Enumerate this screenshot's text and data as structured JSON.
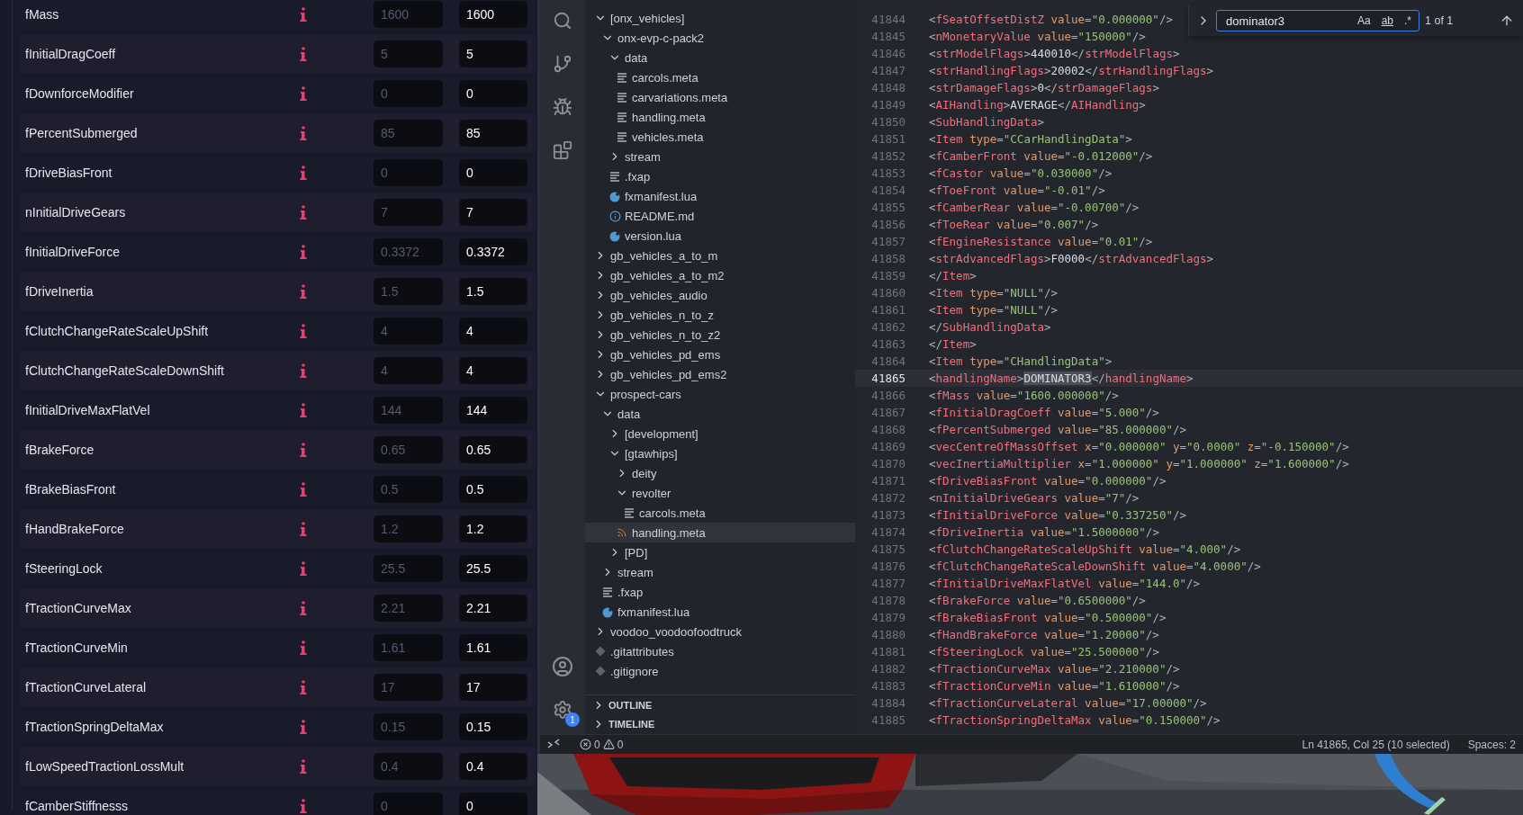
{
  "parameters": [
    {
      "name": "fMass",
      "placeholder": "1600",
      "value": "1600"
    },
    {
      "name": "fInitialDragCoeff",
      "placeholder": "5",
      "value": "5"
    },
    {
      "name": "fDownforceModifier",
      "placeholder": "0",
      "value": "0"
    },
    {
      "name": "fPercentSubmerged",
      "placeholder": "85",
      "value": "85"
    },
    {
      "name": "fDriveBiasFront",
      "placeholder": "0",
      "value": "0"
    },
    {
      "name": "nInitialDriveGears",
      "placeholder": "7",
      "value": "7"
    },
    {
      "name": "fInitialDriveForce",
      "placeholder": "0.3372",
      "value": "0.3372"
    },
    {
      "name": "fDriveInertia",
      "placeholder": "1.5",
      "value": "1.5"
    },
    {
      "name": "fClutchChangeRateScaleUpShift",
      "placeholder": "4",
      "value": "4"
    },
    {
      "name": "fClutchChangeRateScaleDownShift",
      "placeholder": "4",
      "value": "4"
    },
    {
      "name": "fInitialDriveMaxFlatVel",
      "placeholder": "144",
      "value": "144"
    },
    {
      "name": "fBrakeForce",
      "placeholder": "0.65",
      "value": "0.65"
    },
    {
      "name": "fBrakeBiasFront",
      "placeholder": "0.5",
      "value": "0.5"
    },
    {
      "name": "fHandBrakeForce",
      "placeholder": "1.2",
      "value": "1.2"
    },
    {
      "name": "fSteeringLock",
      "placeholder": "25.5",
      "value": "25.5"
    },
    {
      "name": "fTractionCurveMax",
      "placeholder": "2.21",
      "value": "2.21"
    },
    {
      "name": "fTractionCurveMin",
      "placeholder": "1.61",
      "value": "1.61"
    },
    {
      "name": "fTractionCurveLateral",
      "placeholder": "17",
      "value": "17"
    },
    {
      "name": "fTractionSpringDeltaMax",
      "placeholder": "0.15",
      "value": "0.15"
    },
    {
      "name": "fLowSpeedTractionLossMult",
      "placeholder": "0.4",
      "value": "0.4"
    },
    {
      "name": "fCamberStiffnesss",
      "placeholder": "0",
      "value": "0"
    }
  ],
  "activity_bar": {
    "settings_badge": "1"
  },
  "explorer": {
    "tree": [
      {
        "label": "[onx_vehicles]",
        "kind": "folder",
        "expanded": true,
        "selected": false,
        "children": [
          {
            "label": "onx-evp-c-pack2",
            "kind": "folder",
            "expanded": true,
            "selected": false,
            "children": [
              {
                "label": "data",
                "kind": "folder",
                "expanded": true,
                "selected": false,
                "children": [
                  {
                    "label": "carcols.meta",
                    "kind": "text",
                    "selected": false
                  },
                  {
                    "label": "carvariations.meta",
                    "kind": "text",
                    "selected": false
                  },
                  {
                    "label": "handling.meta",
                    "kind": "text",
                    "selected": false
                  },
                  {
                    "label": "vehicles.meta",
                    "kind": "text",
                    "selected": false
                  }
                ]
              },
              {
                "label": "stream",
                "kind": "folder",
                "expanded": false,
                "selected": false
              },
              {
                "label": ".fxap",
                "kind": "text",
                "selected": false
              },
              {
                "label": "fxmanifest.lua",
                "kind": "lua",
                "selected": false
              },
              {
                "label": "README.md",
                "kind": "info",
                "selected": false
              },
              {
                "label": "version.lua",
                "kind": "lua",
                "selected": false
              }
            ]
          }
        ]
      },
      {
        "label": "gb_vehicles_a_to_m",
        "kind": "folder",
        "expanded": false,
        "selected": false
      },
      {
        "label": "gb_vehicles_a_to_m2",
        "kind": "folder",
        "expanded": false,
        "selected": false
      },
      {
        "label": "gb_vehicles_audio",
        "kind": "folder",
        "expanded": false,
        "selected": false
      },
      {
        "label": "gb_vehicles_n_to_z",
        "kind": "folder",
        "expanded": false,
        "selected": false
      },
      {
        "label": "gb_vehicles_n_to_z2",
        "kind": "folder",
        "expanded": false,
        "selected": false
      },
      {
        "label": "gb_vehicles_pd_ems",
        "kind": "folder",
        "expanded": false,
        "selected": false
      },
      {
        "label": "gb_vehicles_pd_ems2",
        "kind": "folder",
        "expanded": false,
        "selected": false
      },
      {
        "label": "prospect-cars",
        "kind": "folder",
        "expanded": true,
        "selected": false,
        "children": [
          {
            "label": "data",
            "kind": "folder",
            "expanded": true,
            "selected": false,
            "children": [
              {
                "label": "[development]",
                "kind": "folder",
                "expanded": false,
                "selected": false
              },
              {
                "label": "[gtawhips]",
                "kind": "folder",
                "expanded": true,
                "selected": false,
                "children": [
                  {
                    "label": "deity",
                    "kind": "folder",
                    "expanded": false,
                    "selected": false
                  },
                  {
                    "label": "revolter",
                    "kind": "folder",
                    "expanded": true,
                    "selected": false,
                    "children": [
                      {
                        "label": "carcols.meta",
                        "kind": "text",
                        "selected": false
                      }
                    ]
                  },
                  {
                    "label": "handling.meta",
                    "kind": "rss",
                    "selected": true
                  }
                ]
              },
              {
                "label": "[PD]",
                "kind": "folder",
                "expanded": false,
                "selected": false
              }
            ]
          },
          {
            "label": "stream",
            "kind": "folder",
            "expanded": false,
            "selected": false
          },
          {
            "label": ".fxap",
            "kind": "text",
            "selected": false
          },
          {
            "label": "fxmanifest.lua",
            "kind": "lua",
            "selected": false
          }
        ]
      },
      {
        "label": "voodoo_voodoofoodtruck",
        "kind": "folder",
        "expanded": false,
        "selected": false
      },
      {
        "label": ".gitattributes",
        "kind": "git",
        "selected": false
      },
      {
        "label": ".gitignore",
        "kind": "git",
        "selected": false
      }
    ],
    "sections": [
      {
        "label": "OUTLINE",
        "expanded": false
      },
      {
        "label": "TIMELINE",
        "expanded": false
      }
    ]
  },
  "editor": {
    "find": {
      "query": "dominator3",
      "toggles": [
        {
          "label": "Aa",
          "on": false
        },
        {
          "label": "ab",
          "on": false
        },
        {
          "label": ".*",
          "on": false
        }
      ],
      "result": "1 of 1"
    },
    "lines": [
      {
        "number": "41844",
        "current": false,
        "tokens": [
          {
            "kind": "punct",
            "text": "<"
          },
          {
            "kind": "tag",
            "text": "fSeatOffsetDistZ"
          },
          {
            "kind": "attr",
            "text": " value"
          },
          {
            "kind": "punct",
            "text": "="
          },
          {
            "kind": "string",
            "text": "\"0.000000\""
          },
          {
            "kind": "punct",
            "text": "/>"
          }
        ]
      },
      {
        "number": "41845",
        "current": false,
        "tokens": [
          {
            "kind": "punct",
            "text": "<"
          },
          {
            "kind": "tag",
            "text": "nMonetaryValue"
          },
          {
            "kind": "attr",
            "text": " value"
          },
          {
            "kind": "punct",
            "text": "="
          },
          {
            "kind": "string",
            "text": "\"150000\""
          },
          {
            "kind": "punct",
            "text": "/>"
          }
        ]
      },
      {
        "number": "41846",
        "current": false,
        "tokens": [
          {
            "kind": "punct",
            "text": "<"
          },
          {
            "kind": "tag",
            "text": "strModelFlags"
          },
          {
            "kind": "punct",
            "text": ">"
          },
          {
            "kind": "text",
            "text": "440010"
          },
          {
            "kind": "punct",
            "text": "</"
          },
          {
            "kind": "tag",
            "text": "strModelFlags"
          },
          {
            "kind": "punct",
            "text": ">"
          }
        ]
      },
      {
        "number": "41847",
        "current": false,
        "tokens": [
          {
            "kind": "punct",
            "text": "<"
          },
          {
            "kind": "tag",
            "text": "strHandlingFlags"
          },
          {
            "kind": "punct",
            "text": ">"
          },
          {
            "kind": "text",
            "text": "20002"
          },
          {
            "kind": "punct",
            "text": "</"
          },
          {
            "kind": "tag",
            "text": "strHandlingFlags"
          },
          {
            "kind": "punct",
            "text": ">"
          }
        ]
      },
      {
        "number": "41848",
        "current": false,
        "tokens": [
          {
            "kind": "punct",
            "text": "<"
          },
          {
            "kind": "tag",
            "text": "strDamageFlags"
          },
          {
            "kind": "punct",
            "text": ">"
          },
          {
            "kind": "text",
            "text": "0"
          },
          {
            "kind": "punct",
            "text": "</"
          },
          {
            "kind": "tag",
            "text": "strDamageFlags"
          },
          {
            "kind": "punct",
            "text": ">"
          }
        ]
      },
      {
        "number": "41849",
        "current": false,
        "tokens": [
          {
            "kind": "punct",
            "text": "<"
          },
          {
            "kind": "tag",
            "text": "AIHandling"
          },
          {
            "kind": "punct",
            "text": ">"
          },
          {
            "kind": "text",
            "text": "AVERAGE"
          },
          {
            "kind": "punct",
            "text": "</"
          },
          {
            "kind": "tag",
            "text": "AIHandling"
          },
          {
            "kind": "punct",
            "text": ">"
          }
        ]
      },
      {
        "number": "41850",
        "current": false,
        "tokens": [
          {
            "kind": "punct",
            "text": "<"
          },
          {
            "kind": "tag",
            "text": "SubHandlingData"
          },
          {
            "kind": "punct",
            "text": ">"
          }
        ]
      },
      {
        "number": "41851",
        "current": false,
        "tokens": [
          {
            "kind": "punct",
            "text": "<"
          },
          {
            "kind": "tag",
            "text": "Item"
          },
          {
            "kind": "attr",
            "text": " type"
          },
          {
            "kind": "punct",
            "text": "="
          },
          {
            "kind": "string",
            "text": "\"CCarHandlingData\""
          },
          {
            "kind": "punct",
            "text": ">"
          }
        ]
      },
      {
        "number": "41852",
        "current": false,
        "tokens": [
          {
            "kind": "punct",
            "text": "<"
          },
          {
            "kind": "tag",
            "text": "fCamberFront"
          },
          {
            "kind": "attr",
            "text": " value"
          },
          {
            "kind": "punct",
            "text": "="
          },
          {
            "kind": "string",
            "text": "\"-0.012000\""
          },
          {
            "kind": "punct",
            "text": "/>"
          }
        ]
      },
      {
        "number": "41853",
        "current": false,
        "tokens": [
          {
            "kind": "punct",
            "text": "<"
          },
          {
            "kind": "tag",
            "text": "fCastor"
          },
          {
            "kind": "attr",
            "text": " value"
          },
          {
            "kind": "punct",
            "text": "="
          },
          {
            "kind": "string",
            "text": "\"0.030000\""
          },
          {
            "kind": "punct",
            "text": "/>"
          }
        ]
      },
      {
        "number": "41854",
        "current": false,
        "tokens": [
          {
            "kind": "punct",
            "text": "<"
          },
          {
            "kind": "tag",
            "text": "fToeFront"
          },
          {
            "kind": "attr",
            "text": " value"
          },
          {
            "kind": "punct",
            "text": "="
          },
          {
            "kind": "string",
            "text": "\"-0.01\""
          },
          {
            "kind": "punct",
            "text": "/>"
          }
        ]
      },
      {
        "number": "41855",
        "current": false,
        "tokens": [
          {
            "kind": "punct",
            "text": "<"
          },
          {
            "kind": "tag",
            "text": "fCamberRear"
          },
          {
            "kind": "attr",
            "text": " value"
          },
          {
            "kind": "punct",
            "text": "="
          },
          {
            "kind": "string",
            "text": "\"-0.00700\""
          },
          {
            "kind": "punct",
            "text": "/>"
          }
        ]
      },
      {
        "number": "41856",
        "current": false,
        "tokens": [
          {
            "kind": "punct",
            "text": "<"
          },
          {
            "kind": "tag",
            "text": "fToeRear"
          },
          {
            "kind": "attr",
            "text": " value"
          },
          {
            "kind": "punct",
            "text": "="
          },
          {
            "kind": "string",
            "text": "\"0.007\""
          },
          {
            "kind": "punct",
            "text": "/>"
          }
        ]
      },
      {
        "number": "41857",
        "current": false,
        "tokens": [
          {
            "kind": "punct",
            "text": "<"
          },
          {
            "kind": "tag",
            "text": "fEngineResistance"
          },
          {
            "kind": "attr",
            "text": " value"
          },
          {
            "kind": "punct",
            "text": "="
          },
          {
            "kind": "string",
            "text": "\"0.01\""
          },
          {
            "kind": "punct",
            "text": "/>"
          }
        ]
      },
      {
        "number": "41858",
        "current": false,
        "tokens": [
          {
            "kind": "punct",
            "text": "<"
          },
          {
            "kind": "tag",
            "text": "strAdvancedFlags"
          },
          {
            "kind": "punct",
            "text": ">"
          },
          {
            "kind": "text",
            "text": "F0000"
          },
          {
            "kind": "punct",
            "text": "</"
          },
          {
            "kind": "tag",
            "text": "strAdvancedFlags"
          },
          {
            "kind": "punct",
            "text": ">"
          }
        ]
      },
      {
        "number": "41859",
        "current": false,
        "tokens": [
          {
            "kind": "punct",
            "text": "</"
          },
          {
            "kind": "tag",
            "text": "Item"
          },
          {
            "kind": "punct",
            "text": ">"
          }
        ]
      },
      {
        "number": "41860",
        "current": false,
        "tokens": [
          {
            "kind": "punct",
            "text": "<"
          },
          {
            "kind": "tag",
            "text": "Item"
          },
          {
            "kind": "attr",
            "text": " type"
          },
          {
            "kind": "punct",
            "text": "="
          },
          {
            "kind": "string",
            "text": "\"NULL\""
          },
          {
            "kind": "punct",
            "text": "/>"
          }
        ]
      },
      {
        "number": "41861",
        "current": false,
        "tokens": [
          {
            "kind": "punct",
            "text": "<"
          },
          {
            "kind": "tag",
            "text": "Item"
          },
          {
            "kind": "attr",
            "text": " type"
          },
          {
            "kind": "punct",
            "text": "="
          },
          {
            "kind": "string",
            "text": "\"NULL\""
          },
          {
            "kind": "punct",
            "text": "/>"
          }
        ]
      },
      {
        "number": "41862",
        "current": false,
        "tokens": [
          {
            "kind": "punct",
            "text": "</"
          },
          {
            "kind": "tag",
            "text": "SubHandlingData"
          },
          {
            "kind": "punct",
            "text": ">"
          }
        ]
      },
      {
        "number": "41863",
        "current": false,
        "tokens": [
          {
            "kind": "punct",
            "text": "</"
          },
          {
            "kind": "tag",
            "text": "Item"
          },
          {
            "kind": "punct",
            "text": ">"
          }
        ]
      },
      {
        "number": "41864",
        "current": false,
        "tokens": [
          {
            "kind": "punct",
            "text": "<"
          },
          {
            "kind": "tag",
            "text": "Item"
          },
          {
            "kind": "attr",
            "text": " type"
          },
          {
            "kind": "punct",
            "text": "="
          },
          {
            "kind": "string",
            "text": "\"CHandlingData\""
          },
          {
            "kind": "punct",
            "text": ">"
          }
        ]
      },
      {
        "number": "41865",
        "current": true,
        "tokens": [
          {
            "kind": "punct",
            "text": "<"
          },
          {
            "kind": "tag",
            "text": "handlingName"
          },
          {
            "kind": "punct",
            "text": ">"
          },
          {
            "kind": "selection",
            "text": "DOMINATOR3"
          },
          {
            "kind": "punct",
            "text": "</"
          },
          {
            "kind": "tag",
            "text": "handlingName"
          },
          {
            "kind": "punct",
            "text": ">"
          }
        ]
      },
      {
        "number": "41866",
        "current": false,
        "tokens": [
          {
            "kind": "punct",
            "text": "<"
          },
          {
            "kind": "tag",
            "text": "fMass"
          },
          {
            "kind": "attr",
            "text": " value"
          },
          {
            "kind": "punct",
            "text": "="
          },
          {
            "kind": "string",
            "text": "\"1600.000000\""
          },
          {
            "kind": "punct",
            "text": "/>"
          }
        ]
      },
      {
        "number": "41867",
        "current": false,
        "tokens": [
          {
            "kind": "punct",
            "text": "<"
          },
          {
            "kind": "tag",
            "text": "fInitialDragCoeff"
          },
          {
            "kind": "attr",
            "text": " value"
          },
          {
            "kind": "punct",
            "text": "="
          },
          {
            "kind": "string",
            "text": "\"5.000\""
          },
          {
            "kind": "punct",
            "text": "/>"
          }
        ]
      },
      {
        "number": "41868",
        "current": false,
        "tokens": [
          {
            "kind": "punct",
            "text": "<"
          },
          {
            "kind": "tag",
            "text": "fPercentSubmerged"
          },
          {
            "kind": "attr",
            "text": " value"
          },
          {
            "kind": "punct",
            "text": "="
          },
          {
            "kind": "string",
            "text": "\"85.000000\""
          },
          {
            "kind": "punct",
            "text": "/>"
          }
        ]
      },
      {
        "number": "41869",
        "current": false,
        "tokens": [
          {
            "kind": "punct",
            "text": "<"
          },
          {
            "kind": "tag",
            "text": "vecCentreOfMassOffset"
          },
          {
            "kind": "attr",
            "text": " x"
          },
          {
            "kind": "punct",
            "text": "="
          },
          {
            "kind": "string",
            "text": "\"0.000000\""
          },
          {
            "kind": "attr",
            "text": " y"
          },
          {
            "kind": "punct",
            "text": "="
          },
          {
            "kind": "string",
            "text": "\"0.0000\""
          },
          {
            "kind": "attr",
            "text": " z"
          },
          {
            "kind": "punct",
            "text": "="
          },
          {
            "kind": "string",
            "text": "\"-0.150000\""
          },
          {
            "kind": "punct",
            "text": "/>"
          }
        ]
      },
      {
        "number": "41870",
        "current": false,
        "tokens": [
          {
            "kind": "punct",
            "text": "<"
          },
          {
            "kind": "tag",
            "text": "vecInertiaMultiplier"
          },
          {
            "kind": "attr",
            "text": " x"
          },
          {
            "kind": "punct",
            "text": "="
          },
          {
            "kind": "string",
            "text": "\"1.000000\""
          },
          {
            "kind": "attr",
            "text": " y"
          },
          {
            "kind": "punct",
            "text": "="
          },
          {
            "kind": "string",
            "text": "\"1.000000\""
          },
          {
            "kind": "attr",
            "text": " z"
          },
          {
            "kind": "punct",
            "text": "="
          },
          {
            "kind": "string",
            "text": "\"1.600000\""
          },
          {
            "kind": "punct",
            "text": "/>"
          }
        ]
      },
      {
        "number": "41871",
        "current": false,
        "tokens": [
          {
            "kind": "punct",
            "text": "<"
          },
          {
            "kind": "tag",
            "text": "fDriveBiasFront"
          },
          {
            "kind": "attr",
            "text": " value"
          },
          {
            "kind": "punct",
            "text": "="
          },
          {
            "kind": "string",
            "text": "\"0.000000\""
          },
          {
            "kind": "punct",
            "text": "/>"
          }
        ]
      },
      {
        "number": "41872",
        "current": false,
        "tokens": [
          {
            "kind": "punct",
            "text": "<"
          },
          {
            "kind": "tag",
            "text": "nInitialDriveGears"
          },
          {
            "kind": "attr",
            "text": " value"
          },
          {
            "kind": "punct",
            "text": "="
          },
          {
            "kind": "string",
            "text": "\"7\""
          },
          {
            "kind": "punct",
            "text": "/>"
          }
        ]
      },
      {
        "number": "41873",
        "current": false,
        "tokens": [
          {
            "kind": "punct",
            "text": "<"
          },
          {
            "kind": "tag",
            "text": "fInitialDriveForce"
          },
          {
            "kind": "attr",
            "text": " value"
          },
          {
            "kind": "punct",
            "text": "="
          },
          {
            "kind": "string",
            "text": "\"0.337250\""
          },
          {
            "kind": "punct",
            "text": "/>"
          }
        ]
      },
      {
        "number": "41874",
        "current": false,
        "tokens": [
          {
            "kind": "punct",
            "text": "<"
          },
          {
            "kind": "tag",
            "text": "fDriveInertia"
          },
          {
            "kind": "attr",
            "text": " value"
          },
          {
            "kind": "punct",
            "text": "="
          },
          {
            "kind": "string",
            "text": "\"1.5000000\""
          },
          {
            "kind": "punct",
            "text": "/>"
          }
        ]
      },
      {
        "number": "41875",
        "current": false,
        "tokens": [
          {
            "kind": "punct",
            "text": "<"
          },
          {
            "kind": "tag",
            "text": "fClutchChangeRateScaleUpShift"
          },
          {
            "kind": "attr",
            "text": " value"
          },
          {
            "kind": "punct",
            "text": "="
          },
          {
            "kind": "string",
            "text": "\"4.000\""
          },
          {
            "kind": "punct",
            "text": "/>"
          }
        ]
      },
      {
        "number": "41876",
        "current": false,
        "tokens": [
          {
            "kind": "punct",
            "text": "<"
          },
          {
            "kind": "tag",
            "text": "fClutchChangeRateScaleDownShift"
          },
          {
            "kind": "attr",
            "text": " value"
          },
          {
            "kind": "punct",
            "text": "="
          },
          {
            "kind": "string",
            "text": "\"4.0000\""
          },
          {
            "kind": "punct",
            "text": "/>"
          }
        ]
      },
      {
        "number": "41877",
        "current": false,
        "tokens": [
          {
            "kind": "punct",
            "text": "<"
          },
          {
            "kind": "tag",
            "text": "fInitialDriveMaxFlatVel"
          },
          {
            "kind": "attr",
            "text": " value"
          },
          {
            "kind": "punct",
            "text": "="
          },
          {
            "kind": "string",
            "text": "\"144.0\""
          },
          {
            "kind": "punct",
            "text": "/>"
          }
        ]
      },
      {
        "number": "41878",
        "current": false,
        "tokens": [
          {
            "kind": "punct",
            "text": "<"
          },
          {
            "kind": "tag",
            "text": "fBrakeForce"
          },
          {
            "kind": "attr",
            "text": " value"
          },
          {
            "kind": "punct",
            "text": "="
          },
          {
            "kind": "string",
            "text": "\"0.6500000\""
          },
          {
            "kind": "punct",
            "text": "/>"
          }
        ]
      },
      {
        "number": "41879",
        "current": false,
        "tokens": [
          {
            "kind": "punct",
            "text": "<"
          },
          {
            "kind": "tag",
            "text": "fBrakeBiasFront"
          },
          {
            "kind": "attr",
            "text": " value"
          },
          {
            "kind": "punct",
            "text": "="
          },
          {
            "kind": "string",
            "text": "\"0.500000\""
          },
          {
            "kind": "punct",
            "text": "/>"
          }
        ]
      },
      {
        "number": "41880",
        "current": false,
        "tokens": [
          {
            "kind": "punct",
            "text": "<"
          },
          {
            "kind": "tag",
            "text": "fHandBrakeForce"
          },
          {
            "kind": "attr",
            "text": " value"
          },
          {
            "kind": "punct",
            "text": "="
          },
          {
            "kind": "string",
            "text": "\"1.20000\""
          },
          {
            "kind": "punct",
            "text": "/>"
          }
        ]
      },
      {
        "number": "41881",
        "current": false,
        "tokens": [
          {
            "kind": "punct",
            "text": "<"
          },
          {
            "kind": "tag",
            "text": "fSteeringLock"
          },
          {
            "kind": "attr",
            "text": " value"
          },
          {
            "kind": "punct",
            "text": "="
          },
          {
            "kind": "string",
            "text": "\"25.500000\""
          },
          {
            "kind": "punct",
            "text": "/>"
          }
        ]
      },
      {
        "number": "41882",
        "current": false,
        "tokens": [
          {
            "kind": "punct",
            "text": "<"
          },
          {
            "kind": "tag",
            "text": "fTractionCurveMax"
          },
          {
            "kind": "attr",
            "text": " value"
          },
          {
            "kind": "punct",
            "text": "="
          },
          {
            "kind": "string",
            "text": "\"2.210000\""
          },
          {
            "kind": "punct",
            "text": "/>"
          }
        ]
      },
      {
        "number": "41883",
        "current": false,
        "tokens": [
          {
            "kind": "punct",
            "text": "<"
          },
          {
            "kind": "tag",
            "text": "fTractionCurveMin"
          },
          {
            "kind": "attr",
            "text": " value"
          },
          {
            "kind": "punct",
            "text": "="
          },
          {
            "kind": "string",
            "text": "\"1.610000\""
          },
          {
            "kind": "punct",
            "text": "/>"
          }
        ]
      },
      {
        "number": "41884",
        "current": false,
        "tokens": [
          {
            "kind": "punct",
            "text": "<"
          },
          {
            "kind": "tag",
            "text": "fTractionCurveLateral"
          },
          {
            "kind": "attr",
            "text": " value"
          },
          {
            "kind": "punct",
            "text": "="
          },
          {
            "kind": "string",
            "text": "\"17.00000\""
          },
          {
            "kind": "punct",
            "text": "/>"
          }
        ]
      },
      {
        "number": "41885",
        "current": false,
        "tokens": [
          {
            "kind": "punct",
            "text": "<"
          },
          {
            "kind": "tag",
            "text": "fTractionSpringDeltaMax"
          },
          {
            "kind": "attr",
            "text": " value"
          },
          {
            "kind": "punct",
            "text": "="
          },
          {
            "kind": "string",
            "text": "\"0.150000\""
          },
          {
            "kind": "punct",
            "text": "/>"
          }
        ]
      }
    ]
  },
  "status_bar": {
    "errors": "0",
    "warnings": "0",
    "position": "Ln 41865, Col 25 (10 selected)",
    "indentation": "Spaces: 2"
  }
}
